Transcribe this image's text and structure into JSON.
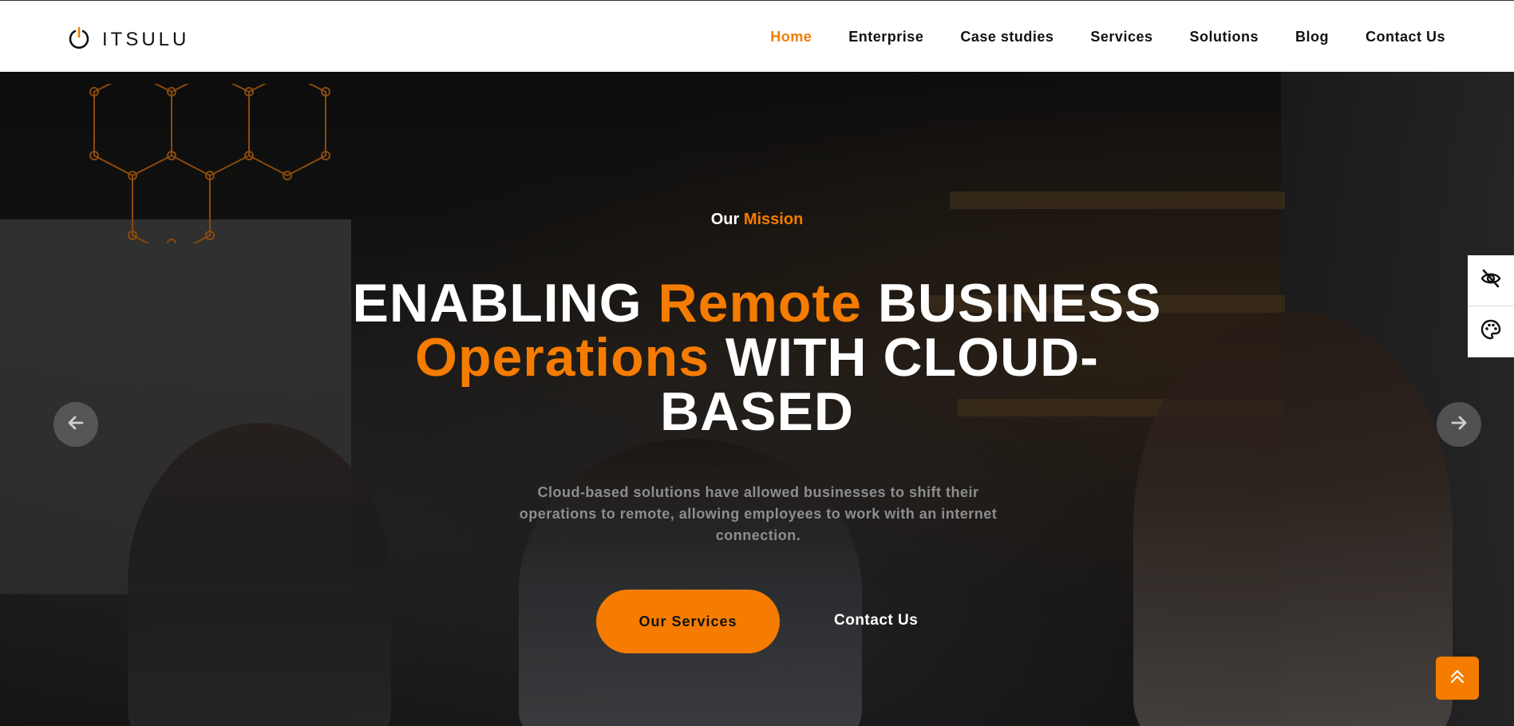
{
  "brand": {
    "name": "ITSULU",
    "icon": "power-icon"
  },
  "nav": {
    "items": [
      {
        "label": "Home",
        "active": true
      },
      {
        "label": "Enterprise",
        "active": false
      },
      {
        "label": "Case studies",
        "active": false
      },
      {
        "label": "Services",
        "active": false
      },
      {
        "label": "Solutions",
        "active": false
      },
      {
        "label": "Blog",
        "active": false
      },
      {
        "label": "Contact Us",
        "active": false
      }
    ]
  },
  "hero": {
    "kicker": {
      "prefix": "Our",
      "accent": "Mission"
    },
    "headline": {
      "part1": "ENABLING",
      "accent1": "Remote",
      "part2": "BUSINESS",
      "accent2": "Operations",
      "part3": "WITH CLOUD-BASED"
    },
    "description": "Cloud-based solutions have allowed businesses to shift their operations to remote, allowing employees to work with an internet connection.",
    "primary_button": "Our Services",
    "secondary_link": "Contact Us",
    "prev_icon": "arrow-left-icon",
    "next_icon": "arrow-right-icon"
  },
  "side_tools": [
    {
      "icon": "eye-slash-icon"
    },
    {
      "icon": "palette-icon"
    }
  ],
  "back_to_top": {
    "icon": "double-chevron-up-icon"
  },
  "colors": {
    "accent": "#f57c00",
    "header_bg": "#ffffff",
    "text_dark": "#111111"
  }
}
